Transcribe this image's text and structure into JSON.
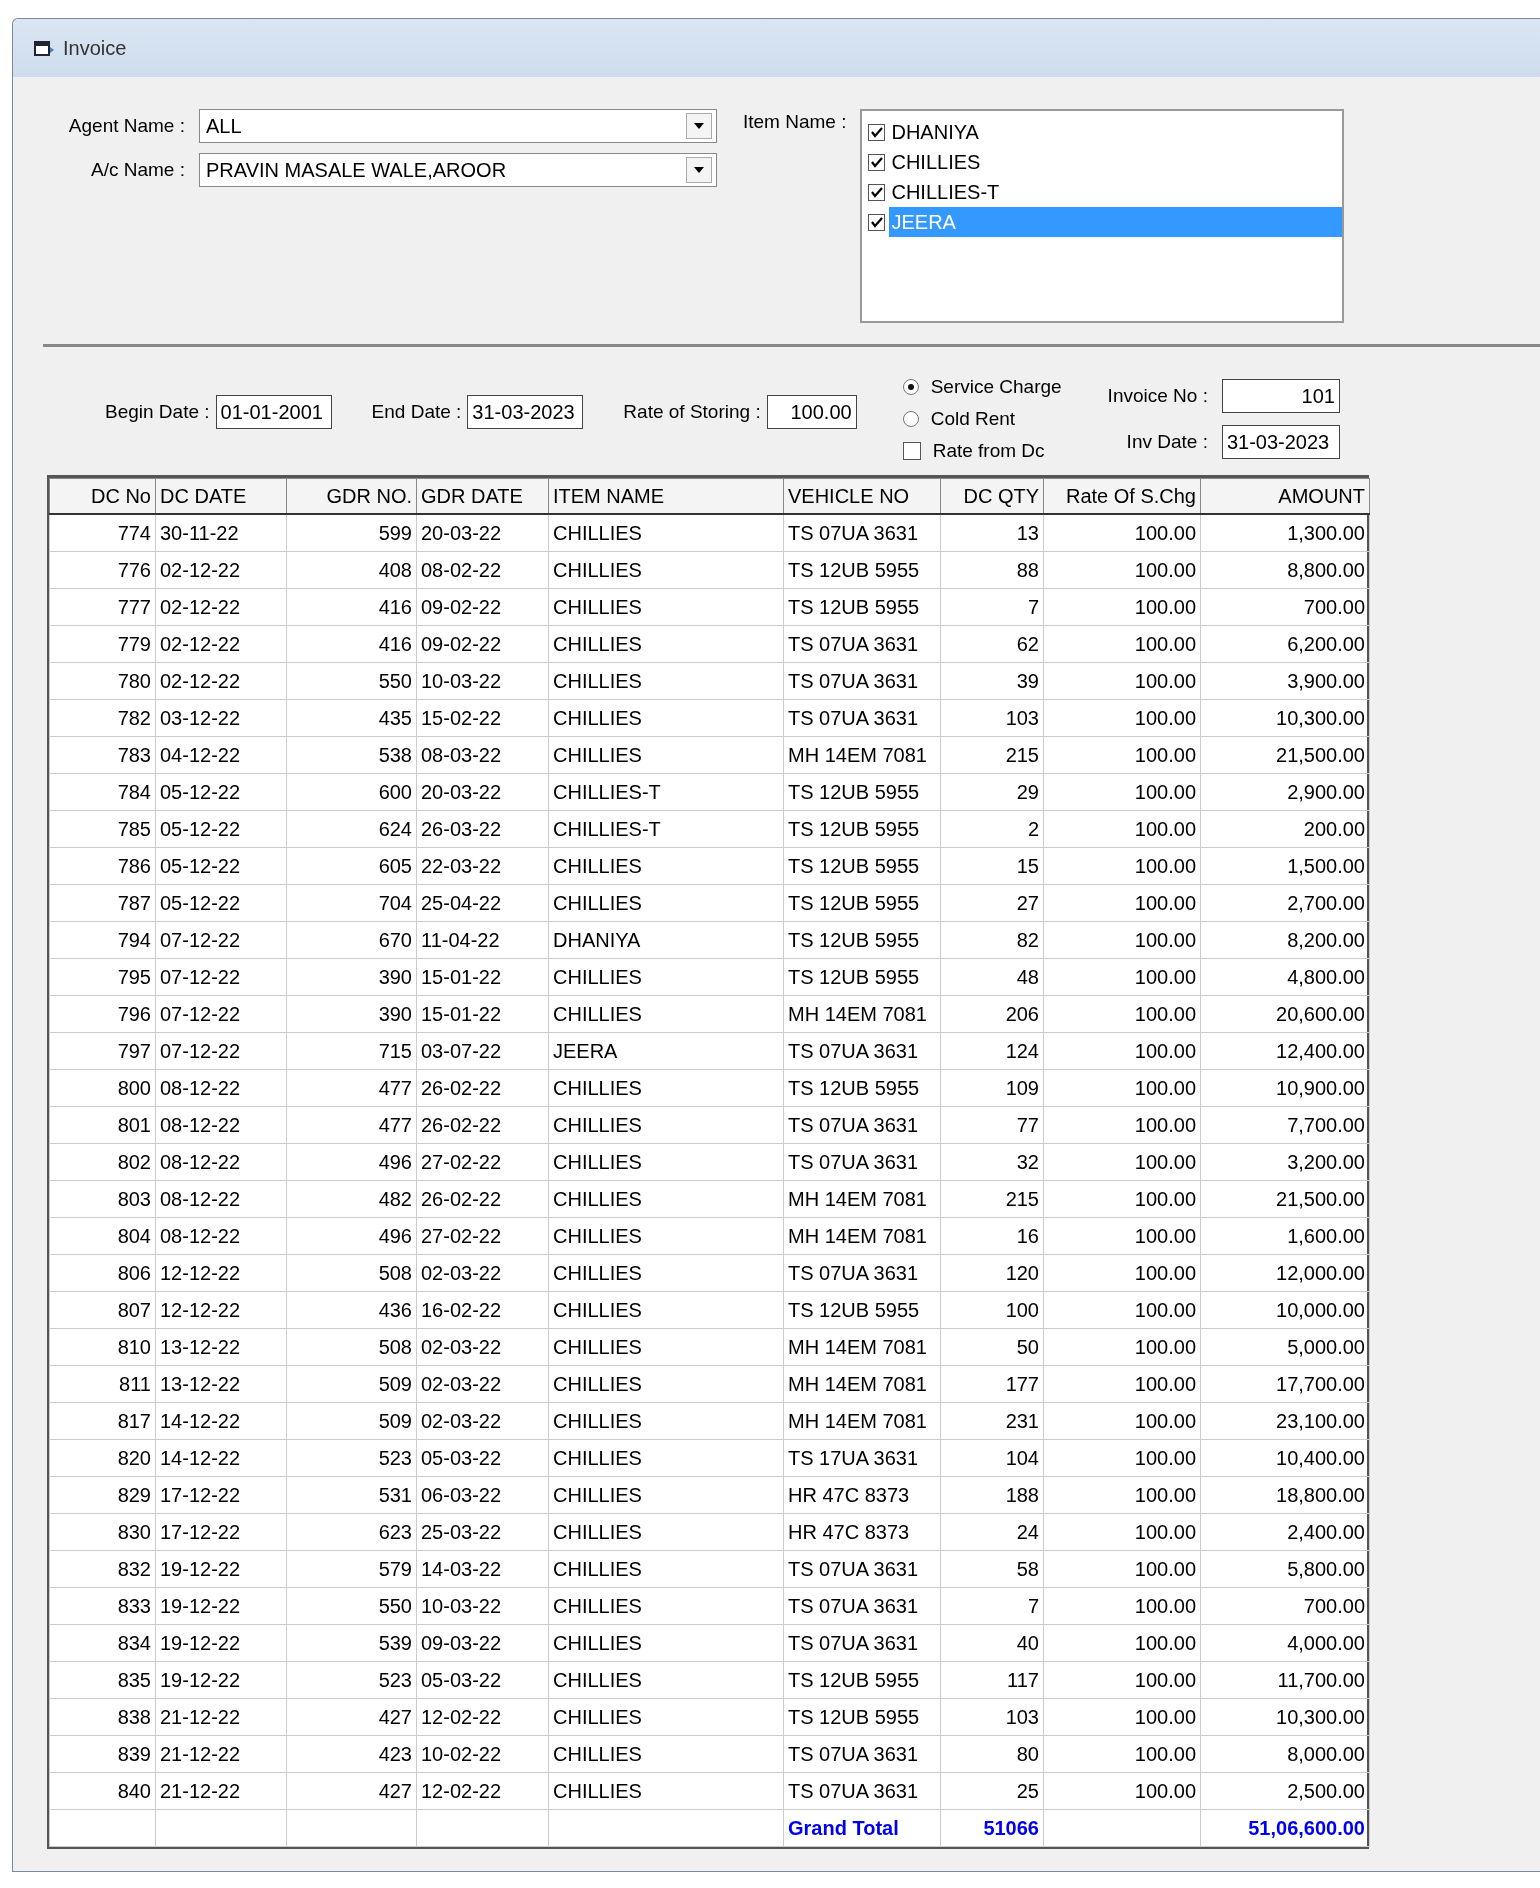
{
  "window": {
    "title": "Invoice"
  },
  "filters": {
    "agent_name": {
      "label": "Agent Name :",
      "value": "ALL"
    },
    "ac_name": {
      "label": "A/c Name :",
      "value": "PRAVIN MASALE WALE,AROOR"
    },
    "item_name": {
      "label": "Item Name :",
      "items": [
        {
          "label": "DHANIYA",
          "checked": true,
          "selected": false
        },
        {
          "label": "CHILLIES",
          "checked": true,
          "selected": false
        },
        {
          "label": "CHILLIES-T",
          "checked": true,
          "selected": false
        },
        {
          "label": "JEERA",
          "checked": true,
          "selected": true
        }
      ]
    }
  },
  "params": {
    "begin_date": {
      "label": "Begin Date :",
      "value": "01-01-2001"
    },
    "end_date": {
      "label": "End Date :",
      "value": "31-03-2023"
    },
    "rate_of_storing": {
      "label": "Rate of Storing :",
      "value": "100.00"
    },
    "charge_options": [
      {
        "label": "Service Charge",
        "selected": true
      },
      {
        "label": "Cold Rent",
        "selected": false
      }
    ],
    "rate_from_dc": {
      "label": "Rate from Dc",
      "checked": false
    },
    "invoice_no": {
      "label": "Invoice No :",
      "value": "101"
    },
    "inv_date": {
      "label": "Inv Date :",
      "value": "31-03-2023"
    }
  },
  "table": {
    "columns": [
      "DC No",
      "DC DATE",
      "GDR NO.",
      "GDR DATE",
      "ITEM NAME",
      "VEHICLE NO",
      "DC QTY",
      "Rate Of S.Chg",
      "AMOUNT"
    ],
    "rows": [
      [
        "774",
        "30-11-22",
        "599",
        "20-03-22",
        "CHILLIES",
        "TS 07UA 3631",
        "13",
        "100.00",
        "1,300.00"
      ],
      [
        "776",
        "02-12-22",
        "408",
        "08-02-22",
        "CHILLIES",
        "TS 12UB 5955",
        "88",
        "100.00",
        "8,800.00"
      ],
      [
        "777",
        "02-12-22",
        "416",
        "09-02-22",
        "CHILLIES",
        "TS 12UB 5955",
        "7",
        "100.00",
        "700.00"
      ],
      [
        "779",
        "02-12-22",
        "416",
        "09-02-22",
        "CHILLIES",
        "TS 07UA 3631",
        "62",
        "100.00",
        "6,200.00"
      ],
      [
        "780",
        "02-12-22",
        "550",
        "10-03-22",
        "CHILLIES",
        "TS 07UA 3631",
        "39",
        "100.00",
        "3,900.00"
      ],
      [
        "782",
        "03-12-22",
        "435",
        "15-02-22",
        "CHILLIES",
        "TS 07UA 3631",
        "103",
        "100.00",
        "10,300.00"
      ],
      [
        "783",
        "04-12-22",
        "538",
        "08-03-22",
        "CHILLIES",
        "MH 14EM 7081",
        "215",
        "100.00",
        "21,500.00"
      ],
      [
        "784",
        "05-12-22",
        "600",
        "20-03-22",
        "CHILLIES-T",
        "TS 12UB 5955",
        "29",
        "100.00",
        "2,900.00"
      ],
      [
        "785",
        "05-12-22",
        "624",
        "26-03-22",
        "CHILLIES-T",
        "TS 12UB 5955",
        "2",
        "100.00",
        "200.00"
      ],
      [
        "786",
        "05-12-22",
        "605",
        "22-03-22",
        "CHILLIES",
        "TS 12UB 5955",
        "15",
        "100.00",
        "1,500.00"
      ],
      [
        "787",
        "05-12-22",
        "704",
        "25-04-22",
        "CHILLIES",
        "TS 12UB 5955",
        "27",
        "100.00",
        "2,700.00"
      ],
      [
        "794",
        "07-12-22",
        "670",
        "11-04-22",
        "DHANIYA",
        "TS 12UB 5955",
        "82",
        "100.00",
        "8,200.00"
      ],
      [
        "795",
        "07-12-22",
        "390",
        "15-01-22",
        "CHILLIES",
        "TS 12UB 5955",
        "48",
        "100.00",
        "4,800.00"
      ],
      [
        "796",
        "07-12-22",
        "390",
        "15-01-22",
        "CHILLIES",
        "MH 14EM 7081",
        "206",
        "100.00",
        "20,600.00"
      ],
      [
        "797",
        "07-12-22",
        "715",
        "03-07-22",
        "JEERA",
        "TS 07UA 3631",
        "124",
        "100.00",
        "12,400.00"
      ],
      [
        "800",
        "08-12-22",
        "477",
        "26-02-22",
        "CHILLIES",
        "TS 12UB 5955",
        "109",
        "100.00",
        "10,900.00"
      ],
      [
        "801",
        "08-12-22",
        "477",
        "26-02-22",
        "CHILLIES",
        "TS 07UA 3631",
        "77",
        "100.00",
        "7,700.00"
      ],
      [
        "802",
        "08-12-22",
        "496",
        "27-02-22",
        "CHILLIES",
        "TS 07UA 3631",
        "32",
        "100.00",
        "3,200.00"
      ],
      [
        "803",
        "08-12-22",
        "482",
        "26-02-22",
        "CHILLIES",
        "MH 14EM 7081",
        "215",
        "100.00",
        "21,500.00"
      ],
      [
        "804",
        "08-12-22",
        "496",
        "27-02-22",
        "CHILLIES",
        "MH 14EM 7081",
        "16",
        "100.00",
        "1,600.00"
      ],
      [
        "806",
        "12-12-22",
        "508",
        "02-03-22",
        "CHILLIES",
        "TS 07UA 3631",
        "120",
        "100.00",
        "12,000.00"
      ],
      [
        "807",
        "12-12-22",
        "436",
        "16-02-22",
        "CHILLIES",
        "TS 12UB 5955",
        "100",
        "100.00",
        "10,000.00"
      ],
      [
        "810",
        "13-12-22",
        "508",
        "02-03-22",
        "CHILLIES",
        "MH 14EM 7081",
        "50",
        "100.00",
        "5,000.00"
      ],
      [
        "811",
        "13-12-22",
        "509",
        "02-03-22",
        "CHILLIES",
        "MH 14EM 7081",
        "177",
        "100.00",
        "17,700.00"
      ],
      [
        "817",
        "14-12-22",
        "509",
        "02-03-22",
        "CHILLIES",
        "MH 14EM 7081",
        "231",
        "100.00",
        "23,100.00"
      ],
      [
        "820",
        "14-12-22",
        "523",
        "05-03-22",
        "CHILLIES",
        "TS 17UA 3631",
        "104",
        "100.00",
        "10,400.00"
      ],
      [
        "829",
        "17-12-22",
        "531",
        "06-03-22",
        "CHILLIES",
        "HR 47C 8373",
        "188",
        "100.00",
        "18,800.00"
      ],
      [
        "830",
        "17-12-22",
        "623",
        "25-03-22",
        "CHILLIES",
        "HR 47C 8373",
        "24",
        "100.00",
        "2,400.00"
      ],
      [
        "832",
        "19-12-22",
        "579",
        "14-03-22",
        "CHILLIES",
        "TS 07UA 3631",
        "58",
        "100.00",
        "5,800.00"
      ],
      [
        "833",
        "19-12-22",
        "550",
        "10-03-22",
        "CHILLIES",
        "TS 07UA 3631",
        "7",
        "100.00",
        "700.00"
      ],
      [
        "834",
        "19-12-22",
        "539",
        "09-03-22",
        "CHILLIES",
        "TS 07UA 3631",
        "40",
        "100.00",
        "4,000.00"
      ],
      [
        "835",
        "19-12-22",
        "523",
        "05-03-22",
        "CHILLIES",
        "TS 12UB 5955",
        "117",
        "100.00",
        "11,700.00"
      ],
      [
        "838",
        "21-12-22",
        "427",
        "12-02-22",
        "CHILLIES",
        "TS 12UB 5955",
        "103",
        "100.00",
        "10,300.00"
      ],
      [
        "839",
        "21-12-22",
        "423",
        "10-02-22",
        "CHILLIES",
        "TS 07UA 3631",
        "80",
        "100.00",
        "8,000.00"
      ],
      [
        "840",
        "21-12-22",
        "427",
        "12-02-22",
        "CHILLIES",
        "TS 07UA 3631",
        "25",
        "100.00",
        "2,500.00"
      ]
    ],
    "total": {
      "label": "Grand Total",
      "qty": "51066",
      "amount": "51,06,600.00"
    }
  }
}
